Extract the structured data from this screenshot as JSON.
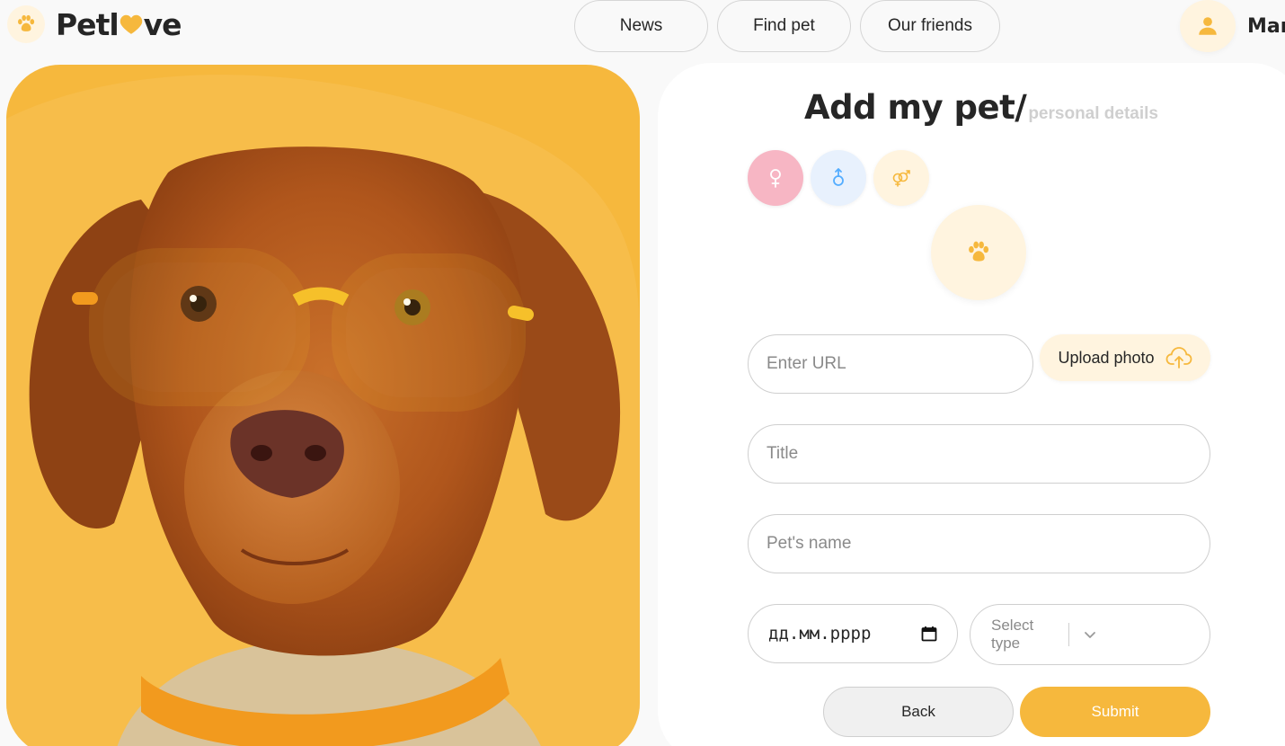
{
  "header": {
    "logo": {
      "text_before": "Petl",
      "text_after": "ve",
      "icon": "paw-icon",
      "heart_icon": "heart-icon"
    },
    "nav": [
      {
        "label": "News"
      },
      {
        "label": "Find pet"
      },
      {
        "label": "Our friends"
      }
    ],
    "user": {
      "name": "Mar",
      "icon": "user-icon"
    }
  },
  "hero": {
    "image": "dog-with-yellow-glasses"
  },
  "form": {
    "title": "Add my pet/",
    "subtitle": "personal details",
    "sex_options": [
      {
        "icon": "female-symbol-icon",
        "selected": true
      },
      {
        "icon": "male-symbol-icon",
        "selected": false
      },
      {
        "icon": "multiple-gender-icon",
        "selected": false
      }
    ],
    "photo_preview_icon": "paw-icon",
    "url_placeholder": "Enter URL",
    "upload_label": "Upload photo",
    "upload_icon": "upload-cloud-icon",
    "title_placeholder": "Title",
    "name_placeholder": "Pet's name",
    "date_placeholder": "дд.мм.рррр",
    "date_icon": "calendar-icon",
    "type_placeholder": "Select type",
    "type_icon": "chevron-down-icon",
    "back_label": "Back",
    "submit_label": "Submit"
  },
  "colors": {
    "accent": "#f6b83d",
    "accent_light": "#fff4df",
    "female": "#f7b6c4",
    "male": "#e8f1fd",
    "text": "#262626",
    "muted": "#8a8a8a"
  }
}
